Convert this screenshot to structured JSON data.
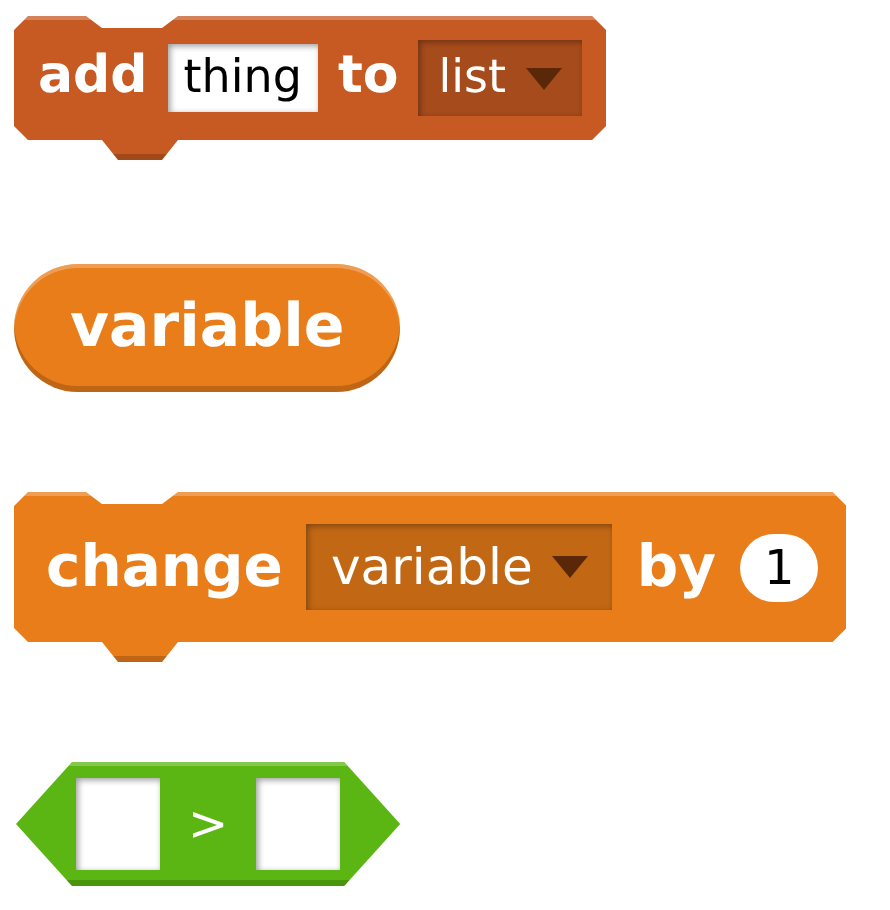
{
  "blocks": [
    {
      "kind": "command",
      "color": "#c65a22",
      "parts": [
        {
          "kind": "label",
          "text": "add"
        },
        {
          "kind": "text",
          "text": "thing"
        },
        {
          "kind": "label",
          "text": "to"
        },
        {
          "kind": "dropdown",
          "text": "list"
        }
      ]
    },
    {
      "kind": "reporter",
      "color": "#e87d1a",
      "parts": [
        {
          "kind": "label",
          "text": "variable"
        }
      ]
    },
    {
      "kind": "command",
      "color": "#e87d1a",
      "parts": [
        {
          "kind": "label",
          "text": "change"
        },
        {
          "kind": "dropdown",
          "text": "variable"
        },
        {
          "kind": "label",
          "text": "by"
        },
        {
          "kind": "number",
          "text": "1"
        }
      ]
    },
    {
      "kind": "boolean",
      "color": "#5bb512",
      "parts": [
        {
          "kind": "empty"
        },
        {
          "kind": "operator",
          "text": ">"
        },
        {
          "kind": "empty"
        }
      ]
    }
  ]
}
